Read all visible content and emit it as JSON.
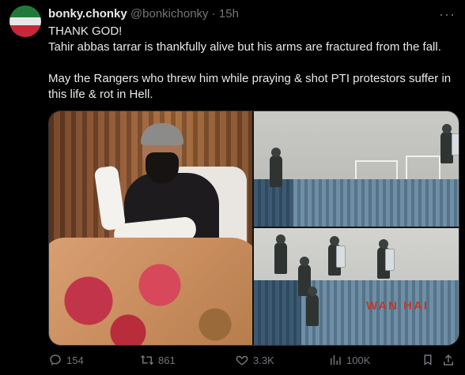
{
  "post": {
    "author_name": "bonky.chonky",
    "author_handle": "@bonkichonky",
    "separator": "·",
    "time": "15h",
    "more_label": "···",
    "lines": [
      "THANK GOD!",
      "Tahir abbas tarrar is thankfully alive but his arms are fractured from the fall.",
      "",
      "May the Rangers who threw him while praying & shot PTI protestors suffer in this life & rot in Hell."
    ],
    "media": {
      "container_text": "WAN HAI"
    }
  },
  "actions": {
    "replies": "154",
    "reposts": "861",
    "likes": "3.3K",
    "views": "100K"
  },
  "colors": {
    "background": "#000000",
    "text": "#e7e9ea",
    "muted": "#71767b",
    "border": "#2f3336"
  },
  "icons": [
    "reply-icon",
    "repost-icon",
    "like-icon",
    "views-icon",
    "bookmark-icon",
    "share-icon",
    "more-icon"
  ]
}
